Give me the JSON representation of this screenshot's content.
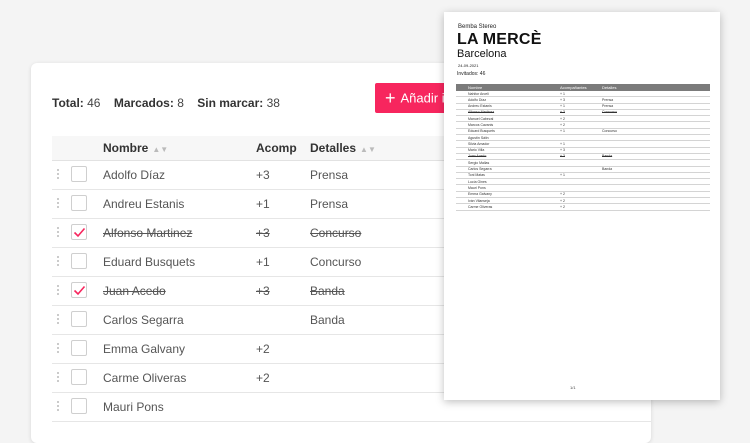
{
  "summary": {
    "total_label": "Total:",
    "total_value": "46",
    "marked_label": "Marcados:",
    "marked_value": "8",
    "unmarked_label": "Sin marcar:",
    "unmarked_value": "38"
  },
  "toolbar": {
    "add_label": "Añadir i",
    "add_icon": "plus-icon"
  },
  "table": {
    "headers": {
      "name": "Nombre",
      "acomp": "Acomp",
      "details": "Detalles"
    },
    "rows": [
      {
        "name": "Adolfo Díaz",
        "acomp": "+3",
        "details": "Prensa",
        "checked": false
      },
      {
        "name": "Andreu Estanis",
        "acomp": "+1",
        "details": "Prensa",
        "checked": false
      },
      {
        "name": "Alfonso Martinez",
        "acomp": "+3",
        "details": "Concurso",
        "checked": true
      },
      {
        "name": "Eduard Busquets",
        "acomp": "+1",
        "details": "Concurso",
        "checked": false
      },
      {
        "name": "Juan Acedo",
        "acomp": "+3",
        "details": "Banda",
        "checked": true
      },
      {
        "name": "Carlos Segarra",
        "acomp": "",
        "details": "Banda",
        "checked": false
      },
      {
        "name": "Emma Galvany",
        "acomp": "+2",
        "details": "",
        "checked": false
      },
      {
        "name": "Carme Oliveras",
        "acomp": "+2",
        "details": "",
        "checked": false
      },
      {
        "name": "Mauri Pons",
        "acomp": "",
        "details": "",
        "checked": false
      }
    ]
  },
  "colors": {
    "accent": "#f7265e"
  },
  "print_preview": {
    "brand": "Bemba Stereo",
    "title": "LA MERCÈ",
    "city": "Barcelona",
    "date": "24-09-2021",
    "guests": "Invitados: 46",
    "headers": {
      "name": "Nombre",
      "acomp": "Acompañantes",
      "details": "Detalles"
    },
    "rows": [
      {
        "name": "Nahitor Arceli",
        "acomp": "+ 1",
        "details": "",
        "checked": false
      },
      {
        "name": "Adolfo Díaz",
        "acomp": "+ 3",
        "details": "Prensa",
        "checked": false
      },
      {
        "name": "Andreu Estanis",
        "acomp": "+ 1",
        "details": "Prensa",
        "checked": false
      },
      {
        "name": "Alfonso Martinez",
        "acomp": "+ 3",
        "details": "Concurso",
        "checked": true
      },
      {
        "name": "Manuel Cabezal",
        "acomp": "+ 2",
        "details": "",
        "checked": false
      },
      {
        "name": "Marcos Cavanis",
        "acomp": "+ 2",
        "details": "",
        "checked": false
      },
      {
        "name": "Eduard Busquets",
        "acomp": "+ 1",
        "details": "Concurso",
        "checked": false
      },
      {
        "name": "Agustín Sáiin",
        "acomp": "",
        "details": "",
        "checked": false
      },
      {
        "name": "Silvia Amador",
        "acomp": "+ 1",
        "details": "",
        "checked": false
      },
      {
        "name": "Mario Villa",
        "acomp": "+ 3",
        "details": "",
        "checked": false
      },
      {
        "name": "Juan Acedo",
        "acomp": "+ 3",
        "details": "Banda",
        "checked": true
      },
      {
        "name": "Sergio Mallas",
        "acomp": "",
        "details": "",
        "checked": false
      },
      {
        "name": "Carlos Segarra",
        "acomp": "",
        "details": "Banda",
        "checked": false
      },
      {
        "name": "Toni Matas",
        "acomp": "+ 1",
        "details": "",
        "checked": false
      },
      {
        "name": "Lucía Gines",
        "acomp": "",
        "details": "",
        "checked": false
      },
      {
        "name": "Mauri Pons",
        "acomp": "",
        "details": "",
        "checked": false
      },
      {
        "name": "Emma Galvany",
        "acomp": "+ 2",
        "details": "",
        "checked": false
      },
      {
        "name": "Iván Vilanseja",
        "acomp": "+ 2",
        "details": "",
        "checked": false
      },
      {
        "name": "Carme Oliveras",
        "acomp": "+ 2",
        "details": "",
        "checked": false
      }
    ],
    "page_number": "1/1"
  }
}
